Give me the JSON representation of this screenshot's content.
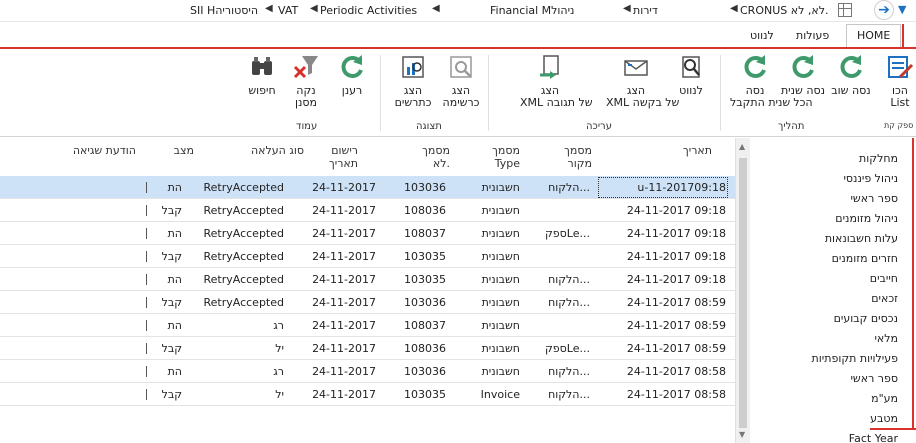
{
  "topbar": {
    "crumbs": [
      "CRONUS לא, לא.",
      "דירות",
      "Financial Mניהול",
      "Periodic Activities",
      "VAT",
      "SII Hהיסטוריה"
    ],
    "back_icon": "back-arrow-icon",
    "forward_icon": "chevron-down-icon"
  },
  "tabs": [
    {
      "label": "HOME",
      "active": true
    },
    {
      "label": "פעולות",
      "active": false
    },
    {
      "label": "לנווט",
      "active": false
    }
  ],
  "ribbon": {
    "buttons": [
      {
        "name": "register-list-button",
        "label1": "הכו",
        "label2": "List",
        "icon": "list-pencil-icon"
      },
      {
        "name": "resend-button",
        "label1": "נסה שוב",
        "label2": "",
        "icon": "refresh-icon"
      },
      {
        "name": "resend-all-button",
        "label1": "נסה שנית",
        "label2": "הכל",
        "icon": "refresh-icon"
      },
      {
        "name": "resend-accepted-button",
        "label1": "נסה",
        "label2": "שנית התקבל",
        "icon": "refresh-icon"
      },
      {
        "name": "navigate-button",
        "label1": "לנווט",
        "label2": "",
        "icon": "magnifier-doc-icon"
      },
      {
        "name": "show-request-xml-button",
        "label1": "הצג",
        "label2": "XML של בקשה",
        "icon": "envelope-icon"
      },
      {
        "name": "show-response-xml-button",
        "label1": "הצג",
        "label2": "XML של תגובה",
        "icon": "doc-arrow-icon"
      },
      {
        "name": "show-list-button",
        "label1": "הצג",
        "label2": "כרשימה",
        "icon": "list-view-icon"
      },
      {
        "name": "show-chart-button",
        "label1": "הצג",
        "label2": "כתרשים",
        "icon": "chart-view-icon"
      },
      {
        "name": "refresh-button",
        "label1": "רענן",
        "label2": "",
        "icon": "refresh-icon"
      },
      {
        "name": "clear-filter-button",
        "label1": "נקה",
        "label2": "מסנן",
        "icon": "clear-filter-icon"
      },
      {
        "name": "find-button",
        "label1": "חיפוש",
        "label2": "",
        "icon": "binoculars-icon"
      }
    ],
    "groups": [
      "ספק קת",
      "תהליך",
      "עריכה",
      "תצוגה",
      "עמוד"
    ]
  },
  "table": {
    "headers": {
      "date": "תאריך",
      "doc_source": "מסמך מקור",
      "doc_type": "מסמך Type",
      "doc_no": "מסמך לא.",
      "posting_date": "רישום תאריך",
      "upload_type": "סוג העלאה",
      "status": "מצב",
      "error_msg": "הודעת שגיאה"
    },
    "rows": [
      {
        "date": "u-11-201709:18",
        "source": "הלקוח...",
        "type": "חשבונית",
        "no": "103036",
        "posting": "24-11-2017",
        "upload": "RetryAccepted",
        "status": "הת",
        "selected": true
      },
      {
        "date": "24-11-2017 09:18",
        "source": "",
        "type": "חשבונית",
        "no": "108036",
        "posting": "24-11-2017",
        "upload": "RetryAccepted",
        "status": "קבל",
        "selected": false
      },
      {
        "date": "24-11-2017 09:18",
        "source": "ספקLe...",
        "type": "חשבונית",
        "no": "108037",
        "posting": "24-11-2017",
        "upload": "RetryAccepted",
        "status": "הת",
        "selected": false
      },
      {
        "date": "24-11-2017 09:18",
        "source": "",
        "type": "חשבונית",
        "no": "103035",
        "posting": "24-11-2017",
        "upload": "RetryAccepted",
        "status": "קבל",
        "selected": false
      },
      {
        "date": "24-11-2017 09:18",
        "source": "הלקוח...",
        "type": "חשבונית",
        "no": "103035",
        "posting": "24-11-2017",
        "upload": "RetryAccepted",
        "status": "הת",
        "selected": false
      },
      {
        "date": "24-11-2017 08:59",
        "source": "הלקוח...",
        "type": "חשבונית",
        "no": "103036",
        "posting": "24-11-2017",
        "upload": "RetryAccepted",
        "status": "קבל",
        "selected": false
      },
      {
        "date": "24-11-2017 08:59",
        "source": "",
        "type": "חשבונית",
        "no": "108037",
        "posting": "24-11-2017",
        "upload": "רג",
        "status": "הת",
        "selected": false
      },
      {
        "date": "24-11-2017 08:59",
        "source": "ספקLe...",
        "type": "חשבונית",
        "no": "108036",
        "posting": "24-11-2017",
        "upload": "יל",
        "status": "קבל",
        "selected": false
      },
      {
        "date": "24-11-2017 08:58",
        "source": "הלקוח...",
        "type": "חשבונית",
        "no": "103036",
        "posting": "24-11-2017",
        "upload": "רג",
        "status": "הת",
        "selected": false
      },
      {
        "date": "24-11-2017 08:58",
        "source": "הלקוח...",
        "type": "Invoice",
        "no": "103035",
        "posting": "24-11-2017",
        "upload": "יל",
        "status": "קבל",
        "selected": false
      }
    ]
  },
  "nav_pane": {
    "items": [
      "מחלקות",
      "ניהול פיננסי",
      "ספר ראשי",
      "ניהול מזומנים",
      "עלות חשבונאות",
      "חזרים מזומנים",
      "חייבים",
      "זכאים",
      "נכסים קבועים",
      "מלאי",
      "פעילויות תקופתיות",
      "ספר ראשי",
      "מע\"מ",
      "מטבע",
      "Fact Year"
    ]
  }
}
